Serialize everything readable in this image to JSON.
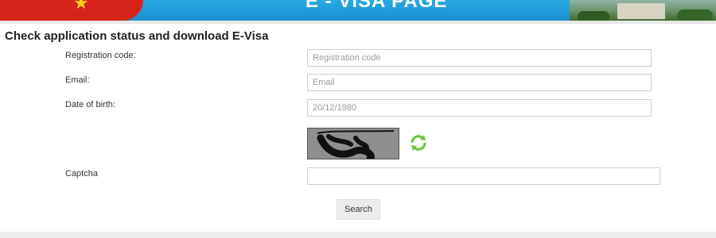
{
  "banner": {
    "title": "E - VISA PAGE",
    "star": "★"
  },
  "form": {
    "heading": "Check application status and download E-Visa",
    "registration": {
      "label": "Registration code:",
      "placeholder": "Registration code",
      "value": ""
    },
    "email": {
      "label": "Email:",
      "placeholder": "Email",
      "value": ""
    },
    "dob": {
      "label": "Date of birth:",
      "placeholder": "20/12/1980",
      "value": ""
    },
    "captcha": {
      "label": "Captcha",
      "value": ""
    },
    "search_label": "Search"
  },
  "icons": {
    "refresh": "refresh-icon"
  },
  "colors": {
    "banner_blue": "#1b8ed0",
    "flag_red": "#d8231b",
    "refresh_green": "#6cc13f"
  }
}
